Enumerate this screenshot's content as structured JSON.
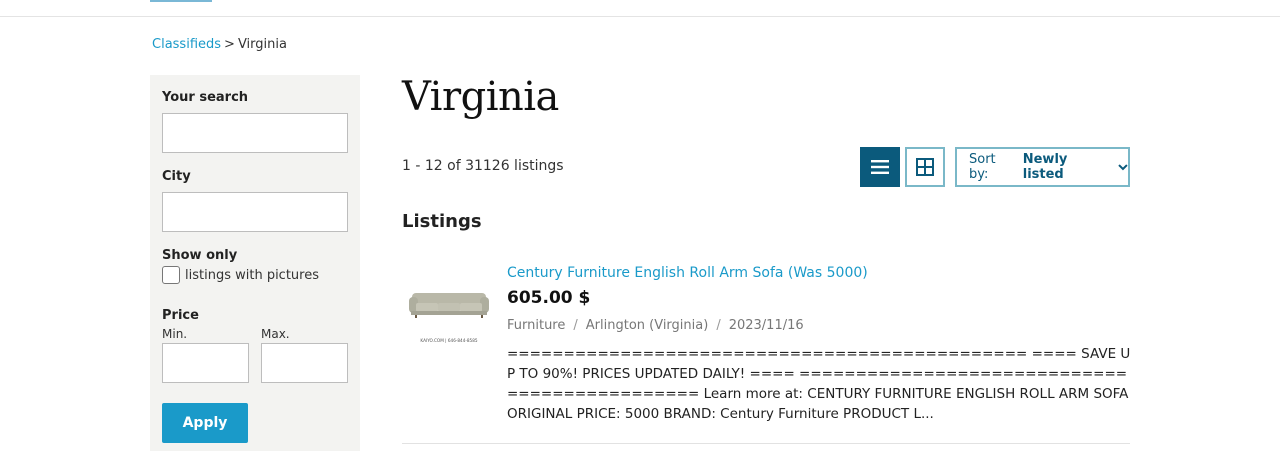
{
  "breadcrumb": {
    "root": "Classifieds",
    "separator": ">",
    "current": "Virginia"
  },
  "filters": {
    "search_label": "Your search",
    "search_value": "",
    "city_label": "City",
    "city_value": "",
    "show_only_label": "Show only",
    "pictures_label": "listings with pictures",
    "pictures_checked": false,
    "price_label": "Price",
    "min_label": "Min.",
    "max_label": "Max.",
    "min_value": "",
    "max_value": "",
    "apply_label": "Apply"
  },
  "main": {
    "title": "Virginia",
    "count_text": "1 - 12 of 31126 listings",
    "sort_prefix": "Sort by:",
    "sort_value": "Newly listed",
    "section_heading": "Listings",
    "view_mode": "list"
  },
  "listings": [
    {
      "title": "Century Furniture English Roll Arm Sofa (Was 5000)",
      "price": "605.00 $",
      "category": "Furniture",
      "location": "Arlington (Virginia)",
      "date": "2023/11/16",
      "image_caption": "KAIYO.COM | 646-844-8585",
      "description": "============================================== ==== SAVE UP TO 90%! PRICES UPDATED DAILY! ==== ============================================== Learn more at: CENTURY FURNITURE ENGLISH ROLL ARM SOFA ORIGINAL PRICE: 5000 BRAND: Century Furniture PRODUCT L..."
    }
  ],
  "colors": {
    "link": "#1a9ac9",
    "primary_dark": "#0b5a7c",
    "apply_button": "#1a9ac9",
    "sidebar_bg": "#f3f3f1"
  },
  "icons": {
    "list_view": "list-icon",
    "grid_view": "grid-icon",
    "sort_chevron": "chevron-down-icon"
  }
}
